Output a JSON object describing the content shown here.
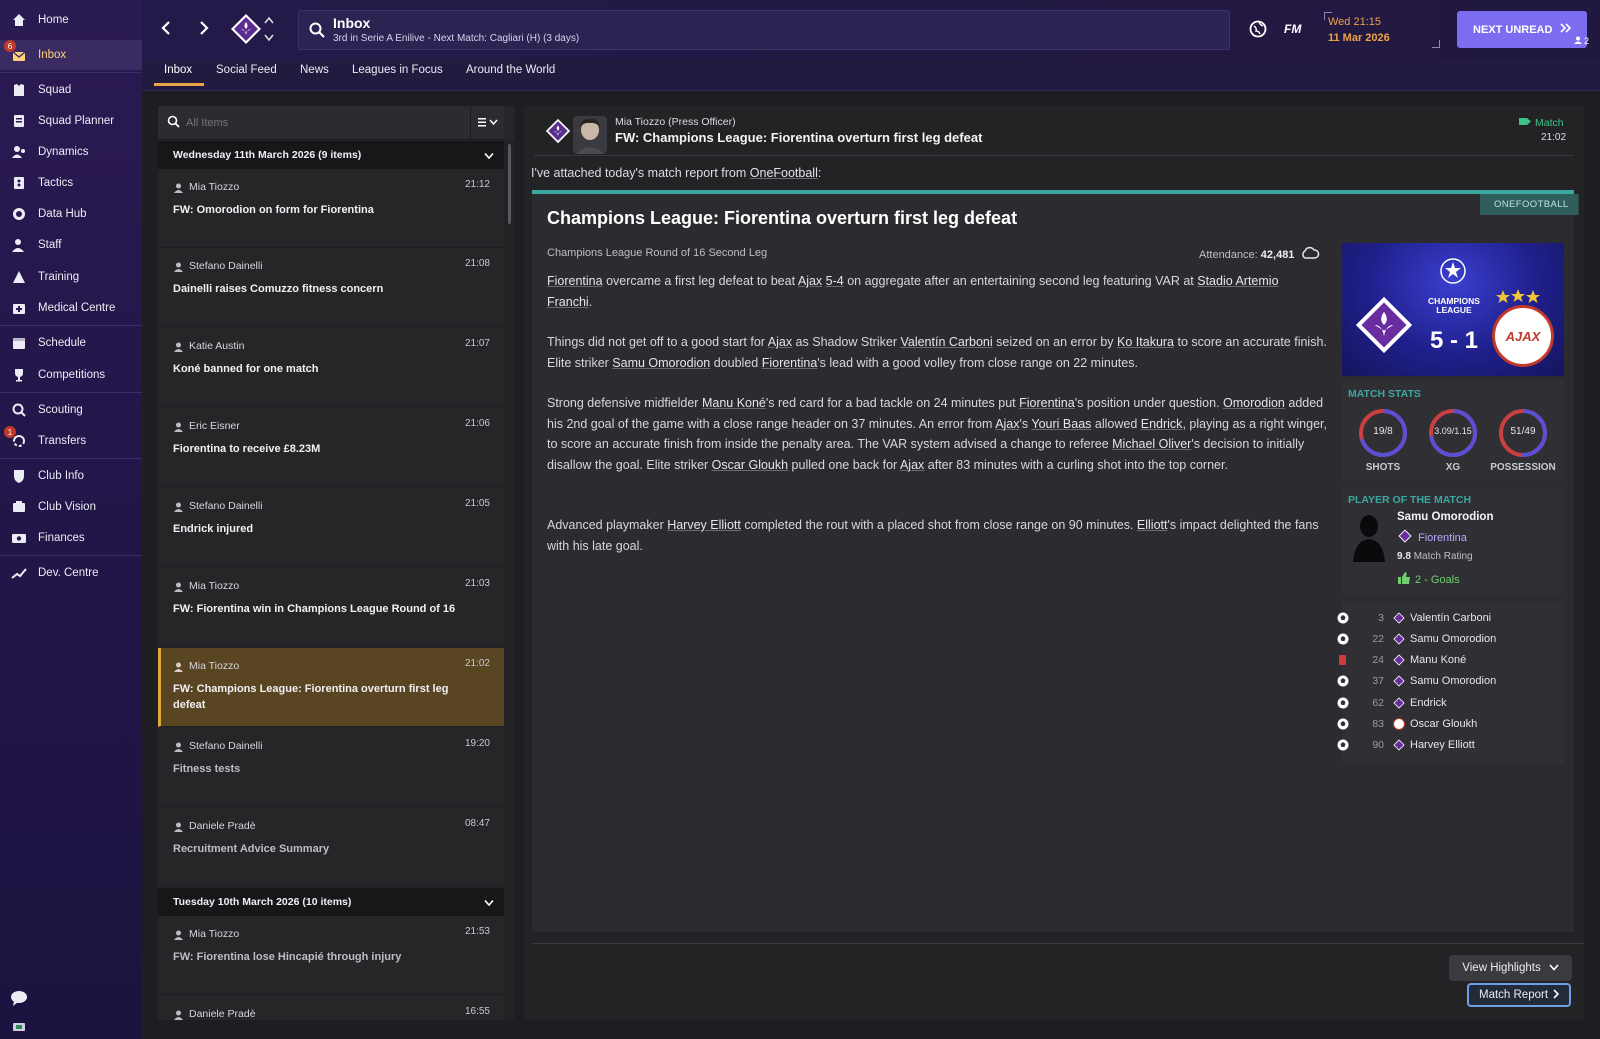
{
  "sidebar": {
    "items": [
      {
        "label": "Home",
        "icon": "home-icon"
      },
      {
        "label": "Inbox",
        "icon": "inbox-icon",
        "badge": "6"
      },
      {
        "label": "Squad",
        "icon": "squad-icon"
      },
      {
        "label": "Squad Planner",
        "icon": "squad-planner-icon"
      },
      {
        "label": "Dynamics",
        "icon": "dynamics-icon"
      },
      {
        "label": "Tactics",
        "icon": "tactics-icon"
      },
      {
        "label": "Data Hub",
        "icon": "data-hub-icon"
      },
      {
        "label": "Staff",
        "icon": "staff-icon"
      },
      {
        "label": "Training",
        "icon": "training-icon"
      },
      {
        "label": "Medical Centre",
        "icon": "medical-centre-icon"
      },
      {
        "label": "Schedule",
        "icon": "schedule-icon"
      },
      {
        "label": "Competitions",
        "icon": "trophy-icon"
      },
      {
        "label": "Scouting",
        "icon": "scouting-icon"
      },
      {
        "label": "Transfers",
        "icon": "transfers-icon",
        "badge": "1"
      },
      {
        "label": "Club Info",
        "icon": "club-info-icon"
      },
      {
        "label": "Club Vision",
        "icon": "club-vision-icon"
      },
      {
        "label": "Finances",
        "icon": "finances-icon"
      },
      {
        "label": "Dev. Centre",
        "icon": "dev-centre-icon"
      }
    ]
  },
  "header": {
    "title": "Inbox",
    "subtitle": "3rd in Serie A Enilive - Next Match: Cagliari (H) (3 days)",
    "fm_label": "FM",
    "date_line1": "Wed 21:15",
    "date_line2": "11 Mar 2026",
    "next_unread": "NEXT UNREAD",
    "manager_count": "2"
  },
  "tabs": [
    "Inbox",
    "Social Feed",
    "News",
    "Leagues in Focus",
    "Around the World"
  ],
  "search": {
    "placeholder": "All Items"
  },
  "groups": [
    {
      "label": "Wednesday 11th March 2026 (9 items)"
    },
    {
      "label": "Tuesday 10th March 2026 (10 items)"
    }
  ],
  "messages": [
    {
      "sender": "Mia Tiozzo",
      "time": "21:12",
      "subject": "FW: Omorodion on form for Fiorentina"
    },
    {
      "sender": "Stefano Dainelli",
      "time": "21:08",
      "subject": "Dainelli raises Comuzzo fitness concern"
    },
    {
      "sender": "Katie Austin",
      "time": "21:07",
      "subject": "Koné banned for one match"
    },
    {
      "sender": "Eric Eisner",
      "time": "21:06",
      "subject": "Fiorentina to receive £8.23M"
    },
    {
      "sender": "Stefano Dainelli",
      "time": "21:05",
      "subject": "Endrick injured"
    },
    {
      "sender": "Mia Tiozzo",
      "time": "21:03",
      "subject": "FW: Fiorentina win in Champions League Round of 16"
    },
    {
      "sender": "Mia Tiozzo",
      "time": "21:02",
      "subject": "FW: Champions League: Fiorentina overturn first leg defeat"
    },
    {
      "sender": "Stefano Dainelli",
      "time": "19:20",
      "subject": "Fitness tests"
    },
    {
      "sender": "Daniele Pradè",
      "time": "08:47",
      "subject": "Recruitment Advice Summary"
    },
    {
      "sender": "Mia Tiozzo",
      "time": "21:53",
      "subject": "FW: Fiorentina lose Hincapié through injury"
    },
    {
      "sender": "Daniele Pradè",
      "time": "16:55",
      "subject": ""
    }
  ],
  "email": {
    "sender": "Mia Tiozzo",
    "role": "(Press Officer)",
    "subject": "FW: Champions League: Fiorentina overturn first leg defeat",
    "category": "Match",
    "time": "21:02",
    "intro_prefix": "I've attached today's match report from ",
    "intro_link": "OneFootball",
    "intro_suffix": ":"
  },
  "article": {
    "source": "ONEFOOTBALL",
    "headline": "Champions League: Fiorentina overturn first leg defeat",
    "round": "Champions League Round of 16 Second Leg",
    "attendance_label": "Attendance:",
    "attendance": "42,481",
    "p1": {
      "a": "Fiorentina",
      "b": " overcame a first leg defeat to beat ",
      "c": "Ajax",
      "d": " ",
      "e": "5-4",
      "f": " on aggregate after an entertaining second leg featuring VAR at ",
      "g": "Stadio Artemio Franchi",
      "h": "."
    },
    "p2": {
      "a": "Things did not get off to a good start for ",
      "b": "Ajax",
      "c": " as Shadow Striker ",
      "d": "Valentín Carboni",
      "e": " seized on an error by ",
      "f": "Ko Itakura",
      "g": " to score an accurate finish. Elite striker ",
      "h": "Samu Omorodion",
      "i": " doubled ",
      "j": "Fiorentina",
      "k": "'s lead with a good volley from close range on 22 minutes."
    },
    "p3": {
      "a": "Strong defensive midfielder ",
      "b": "Manu Koné",
      "c": "'s red card for a bad tackle on 24 minutes put ",
      "d": "Fiorentina",
      "e": "'s position under question. ",
      "f": "Omorodion",
      "g": " added his 2nd goal of the game with a close range header on 37 minutes. An error from ",
      "h": "Ajax",
      "i": "'s ",
      "j": "Youri Baas",
      "k": " allowed ",
      "l": "Endrick",
      "m": ", playing as a right winger, to score an accurate finish from inside the penalty area. The VAR system advised a change to referee ",
      "n": "Michael Oliver",
      "o": "'s decision to initially disallow the goal. Elite striker ",
      "p": "Oscar Gloukh",
      "q": " pulled one back for ",
      "r": "Ajax",
      "s": " after 83 minutes with a curling shot into the top corner."
    },
    "p4": {
      "a": "Advanced playmaker ",
      "b": "Harvey Elliott",
      "c": " completed the rout with a placed shot from close range on 90 minutes. ",
      "d": "Elliott",
      "e": "'s impact delighted the fans with his late goal."
    }
  },
  "scoreboard": {
    "competition_line1": "CHAMPIONS",
    "competition_line2": "LEAGUE",
    "score": "5 - 1",
    "away_crest_text": "AJAX"
  },
  "match_stats": {
    "title": "MATCH STATS",
    "items": [
      {
        "label": "SHOTS",
        "value": "19/8",
        "home": 19,
        "away": 8
      },
      {
        "label": "XG",
        "value": "3.09/1.15",
        "home": 3.09,
        "away": 1.15
      },
      {
        "label": "POSSESSION",
        "value": "51/49",
        "home": 51,
        "away": 49
      }
    ]
  },
  "potm": {
    "title": "PLAYER OF THE MATCH",
    "name": "Samu Omorodion",
    "club": "Fiorentina",
    "rating": "9.8",
    "rating_label": "Match Rating",
    "goals": "2 - Goals"
  },
  "events": [
    {
      "type": "goal",
      "minute": "3",
      "player": "Valentín Carboni",
      "team": "fiorentina"
    },
    {
      "type": "goal",
      "minute": "22",
      "player": "Samu Omorodion",
      "team": "fiorentina"
    },
    {
      "type": "red-card",
      "minute": "24",
      "player": "Manu Koné",
      "team": "fiorentina"
    },
    {
      "type": "goal",
      "minute": "37",
      "player": "Samu Omorodion",
      "team": "fiorentina"
    },
    {
      "type": "goal",
      "minute": "62",
      "player": "Endrick",
      "team": "fiorentina"
    },
    {
      "type": "goal",
      "minute": "83",
      "player": "Oscar Gloukh",
      "team": "ajax"
    },
    {
      "type": "goal",
      "minute": "90",
      "player": "Harvey Elliott",
      "team": "fiorentina"
    }
  ],
  "buttons": {
    "highlights": "View Highlights",
    "match_report": "Match Report"
  },
  "colors": {
    "accent": "#7b6cf0",
    "selected": "#5a4522",
    "teal": "#3aa7a0",
    "stat_green": "#6fcf6f",
    "red": "#d23b3b"
  }
}
